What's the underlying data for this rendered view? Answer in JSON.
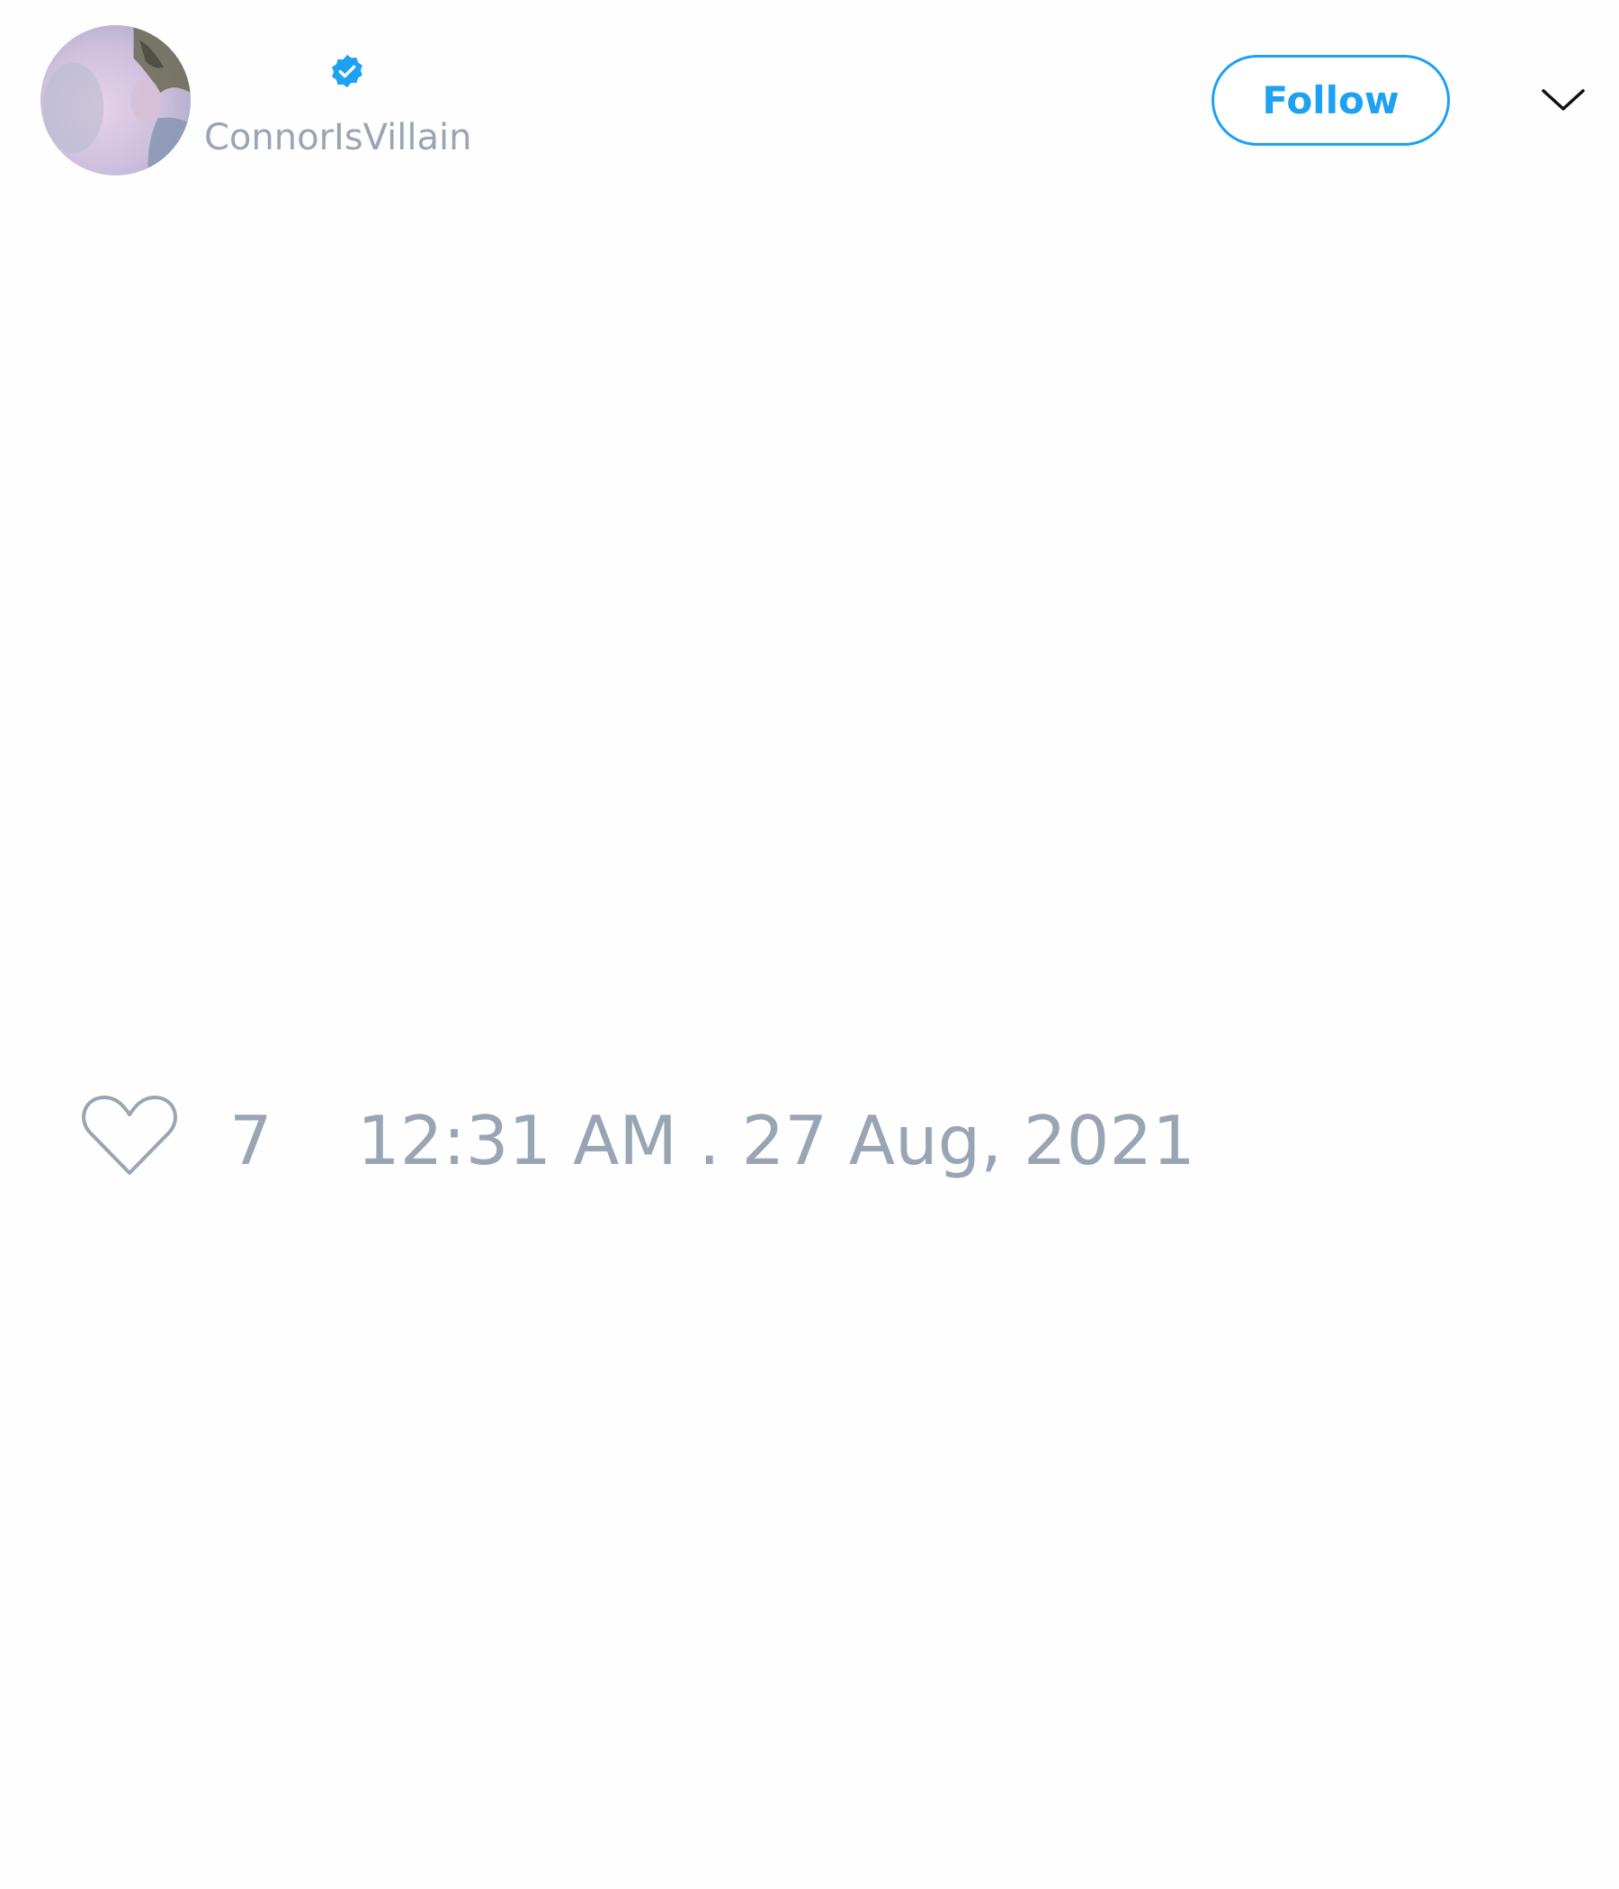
{
  "tweet": {
    "author": {
      "handle": "ConnorIsVillain",
      "verified": true,
      "avatar_icon": "profile-photo"
    },
    "follow_label": "Follow",
    "menu_icon": "chevron-down-icon",
    "like_icon": "heart-outline-icon",
    "likes": "7",
    "timestamp": "12:31 AM . 27 Aug, 2021"
  },
  "colors": {
    "accent": "#1da1f2",
    "muted_text": "#9aa5b4",
    "background": "#fefefe"
  }
}
